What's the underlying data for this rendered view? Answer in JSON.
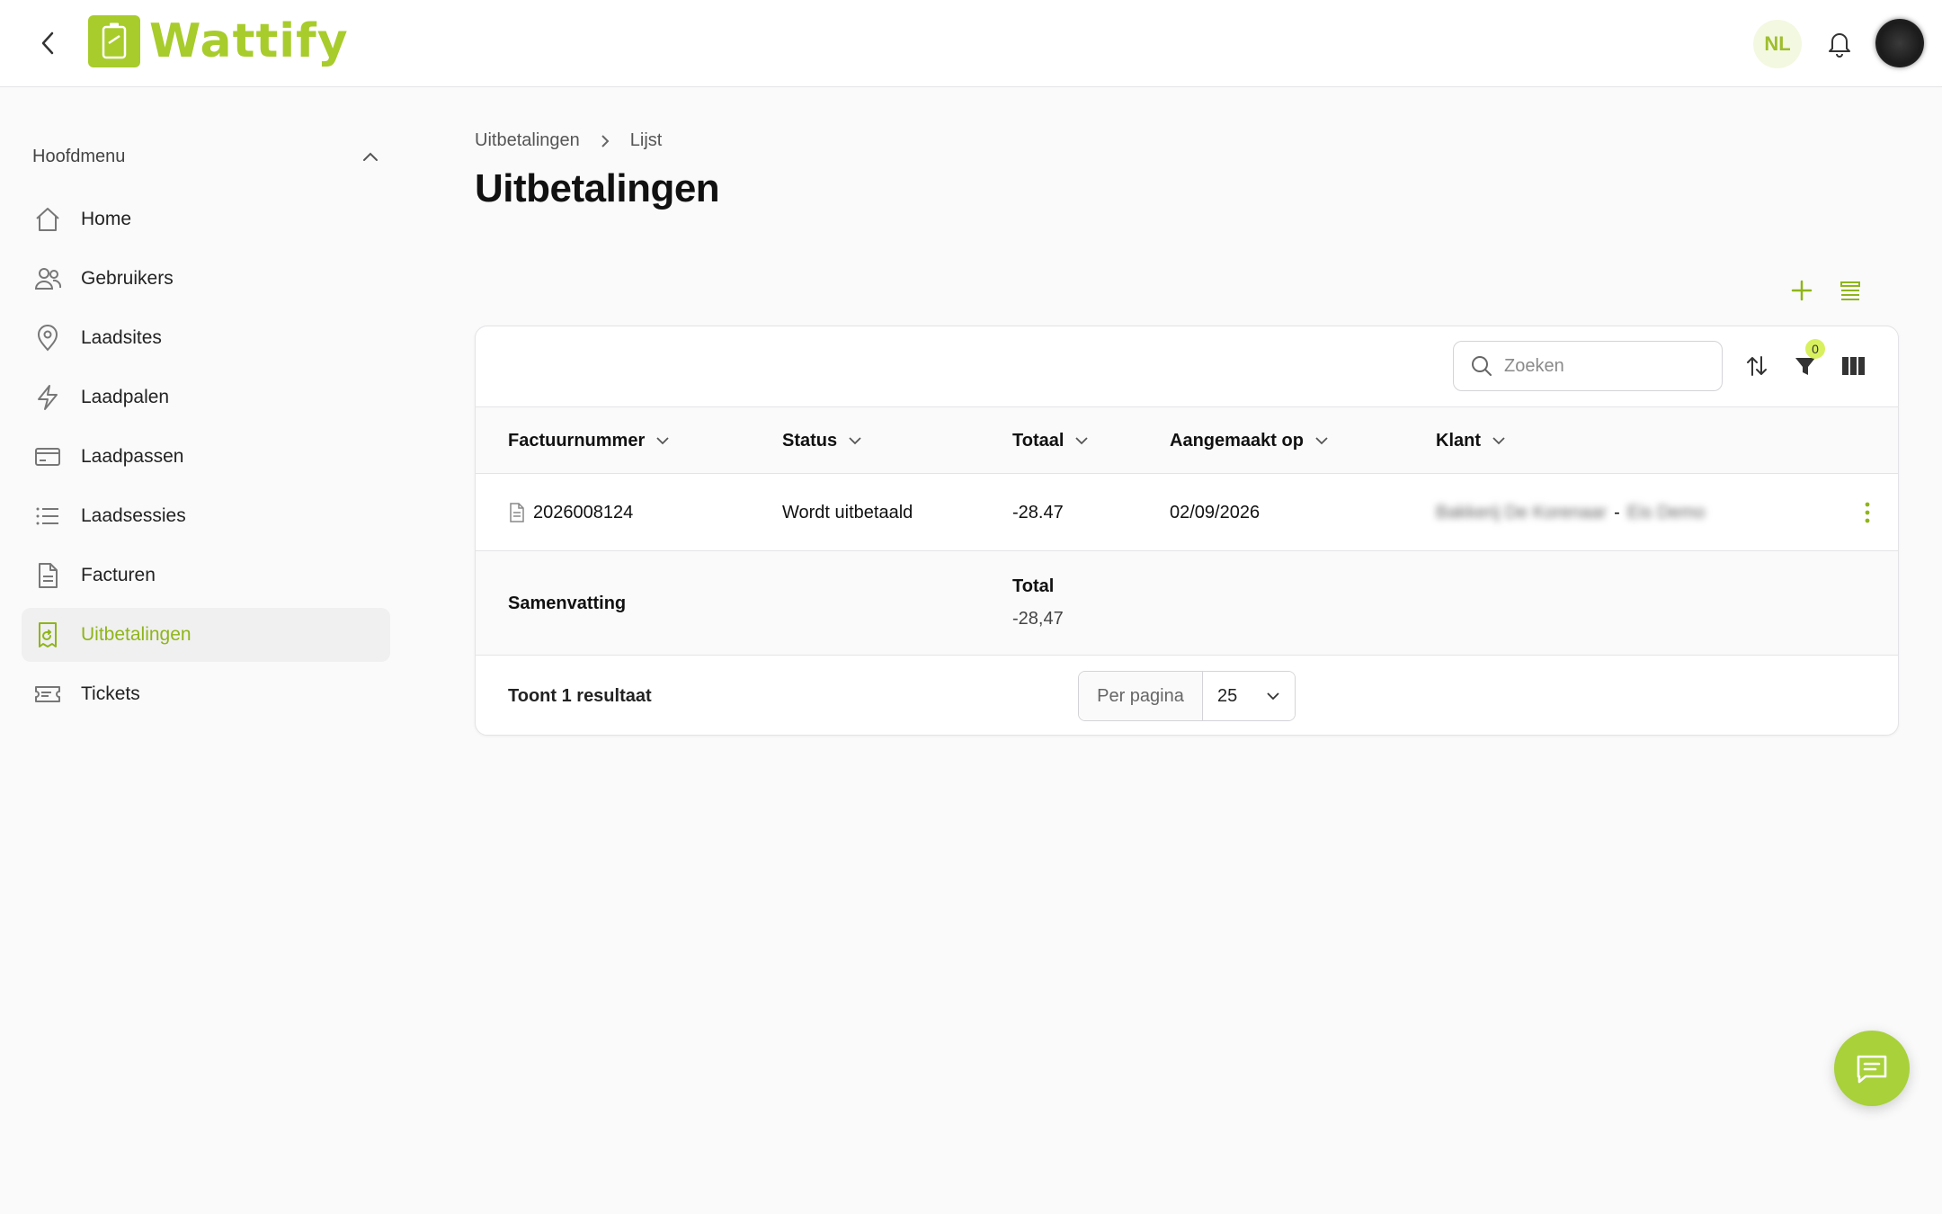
{
  "app": {
    "name": "Wattify",
    "accent_color": "#a8cc2c"
  },
  "header": {
    "language": "NL",
    "back_icon": "chevron-left-icon",
    "bell_icon": "bell-icon"
  },
  "sidebar": {
    "heading": "Hoofdmenu",
    "items": [
      {
        "label": "Home",
        "icon": "home-icon",
        "active": false
      },
      {
        "label": "Gebruikers",
        "icon": "users-icon",
        "active": false
      },
      {
        "label": "Laadsites",
        "icon": "map-pin-icon",
        "active": false
      },
      {
        "label": "Laadpalen",
        "icon": "lightning-icon",
        "active": false
      },
      {
        "label": "Laadpassen",
        "icon": "card-icon",
        "active": false
      },
      {
        "label": "Laadsessies",
        "icon": "list-icon",
        "active": false
      },
      {
        "label": "Facturen",
        "icon": "document-icon",
        "active": false
      },
      {
        "label": "Uitbetalingen",
        "icon": "payout-icon",
        "active": true
      },
      {
        "label": "Tickets",
        "icon": "ticket-icon",
        "active": false
      }
    ]
  },
  "breadcrumb": {
    "parent": "Uitbetalingen",
    "current": "Lijst"
  },
  "page": {
    "title": "Uitbetalingen"
  },
  "toolbar": {
    "search_placeholder": "Zoeken",
    "filter_count": "0"
  },
  "table": {
    "columns": [
      "Factuurnummer",
      "Status",
      "Totaal",
      "Aangemaakt op",
      "Klant"
    ],
    "rows": [
      {
        "factuurnummer": "2026008124",
        "status": "Wordt uitbetaald",
        "totaal": "-28.47",
        "aangemaakt_op": "02/09/2026",
        "klant_name": "Bakkerij De Korenaar",
        "klant_separator": "-",
        "klant_org": "Eis Demo"
      }
    ]
  },
  "summary": {
    "label": "Samenvatting",
    "total_label": "Total",
    "total_value": "-28,47"
  },
  "footer": {
    "results": "Toont 1 resultaat",
    "per_page_label": "Per pagina",
    "per_page_value": "25"
  }
}
